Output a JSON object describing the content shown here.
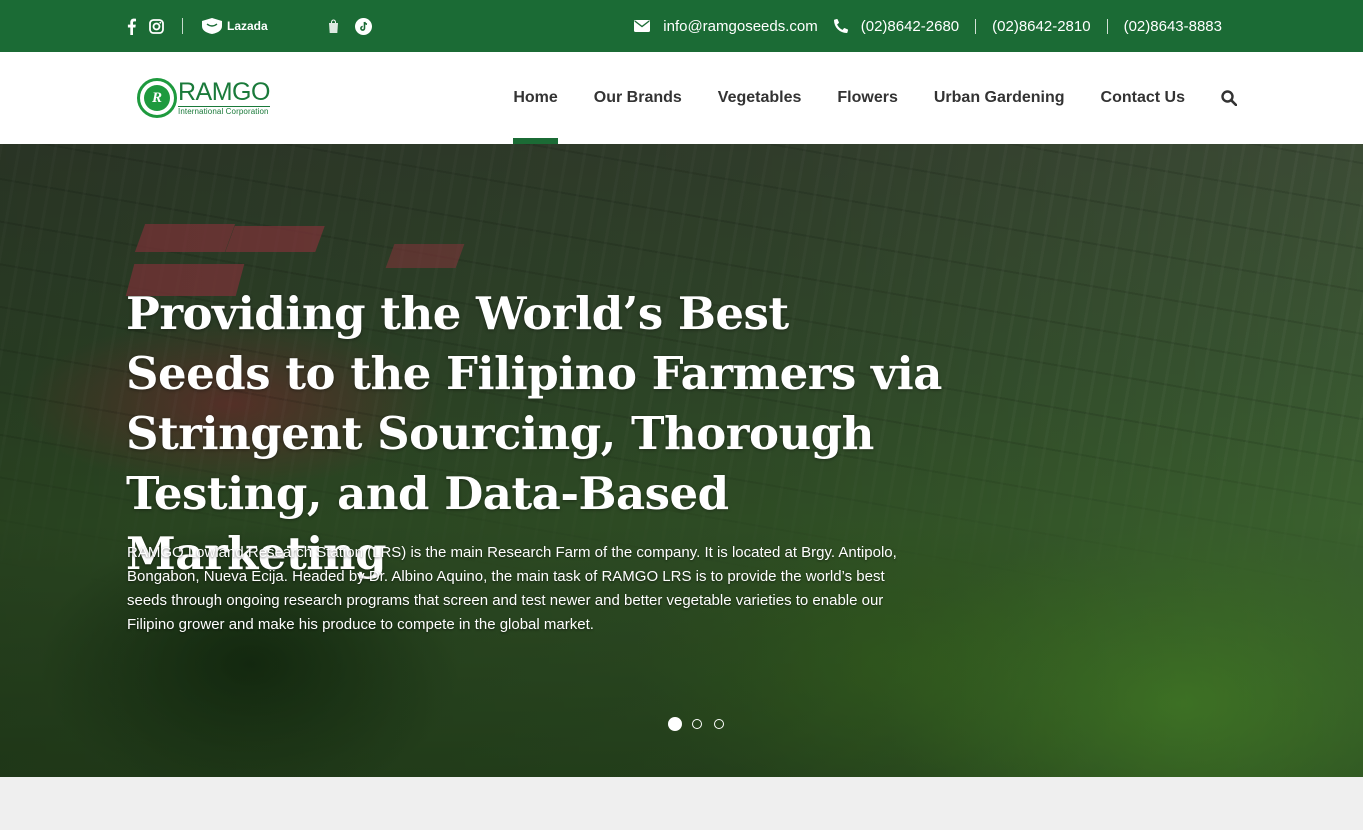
{
  "topbar": {
    "lazada_label": "Lazada",
    "email": "info@ramgoseeds.com",
    "phones": [
      "(02)8642-2680",
      "(02)8642-2810",
      "(02)8643-8883"
    ]
  },
  "header": {
    "logo_name": "RAMGO",
    "logo_sub": "International Corporation",
    "logo_mark": "R",
    "nav": [
      "Home",
      "Our Brands",
      "Vegetables",
      "Flowers",
      "Urban Gardening",
      "Contact Us"
    ],
    "active_nav": "Home"
  },
  "hero": {
    "title": "Providing the World’s Best Seeds to the Filipino Farmers via Stringent Sourcing, Thorough Testing, and Data-Based Marketing",
    "text": "RAMGO Lowland Research Station (LRS) is the main Research Farm of the company. It is located at Brgy. Antipolo, Bongabon, Nueva Ecija. Headed by Dr. Albino Aquino, the main task of RAMGO LRS is to provide the world’s best seeds through ongoing research programs that screen and test newer and better vegetable varieties to enable our Filipino grower and make his produce to compete in the global market.",
    "slides_total": 3,
    "slide_active": 1
  },
  "colors": {
    "brand_green": "#1b6b35",
    "logo_green": "#1e9a3e"
  },
  "icons": [
    "facebook-icon",
    "instagram-icon",
    "lazada-icon",
    "shopee-icon",
    "tiktok-icon",
    "envelope-icon",
    "phone-icon",
    "search-icon"
  ]
}
